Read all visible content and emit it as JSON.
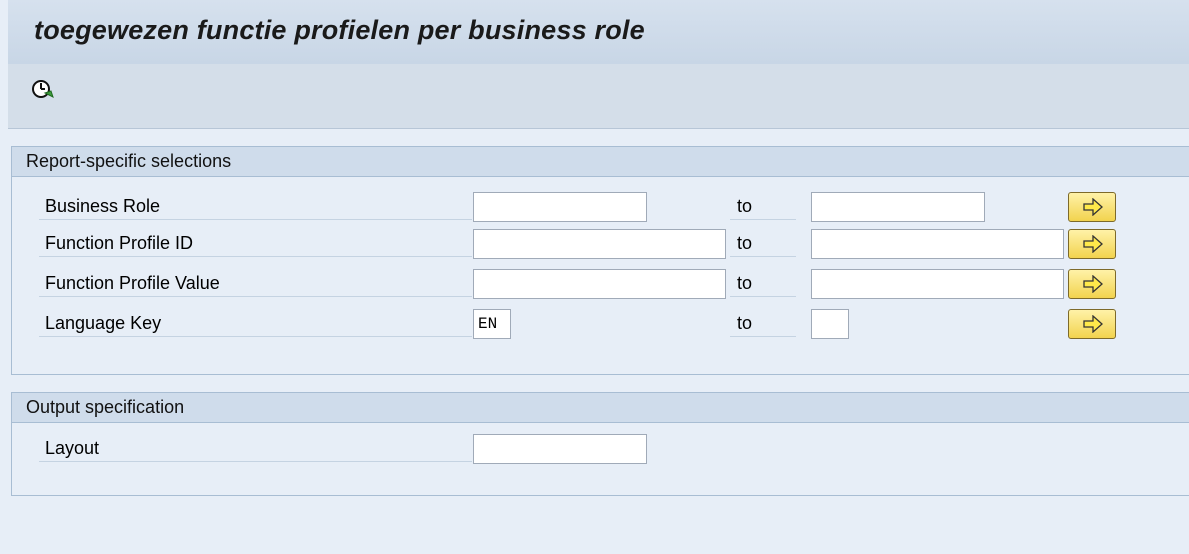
{
  "title": "toegewezen functie profielen per business role",
  "toolbar": {
    "execute_icon": "execute-clock-icon"
  },
  "selections": {
    "header": "Report-specific selections",
    "to_label": "to",
    "rows": [
      {
        "label": "Business Role",
        "from_value": "",
        "to_value": ""
      },
      {
        "label": "Function Profile ID",
        "from_value": "",
        "to_value": ""
      },
      {
        "label": "Function Profile Value",
        "from_value": "",
        "to_value": ""
      },
      {
        "label": "Language Key",
        "from_value": "EN",
        "to_value": ""
      }
    ],
    "multiple_selection_icon": "arrow-right-icon"
  },
  "output": {
    "header": "Output specification",
    "layout_label": "Layout",
    "layout_value": ""
  },
  "colors": {
    "background": "#e7eef7",
    "header_bar": "#cfdceb",
    "arrow_button": "#f2d34e"
  }
}
